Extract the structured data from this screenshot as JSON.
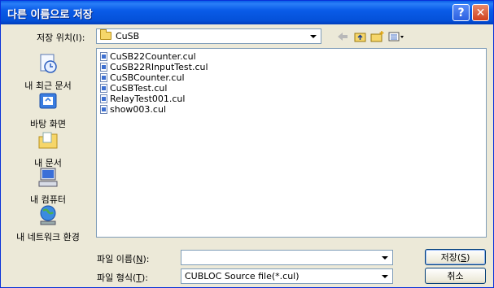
{
  "window": {
    "title": "다른 이름으로 저장",
    "help_glyph": "?",
    "close_glyph": "✕"
  },
  "location": {
    "label": "저장 위치(I):",
    "value": "CuSB"
  },
  "toolbar": {
    "icons": [
      "back-arrow-icon",
      "up-folder-icon",
      "new-folder-icon",
      "view-menu-icon"
    ]
  },
  "places": [
    {
      "label": "내 최근 문서",
      "icon": "recent-documents-icon"
    },
    {
      "label": "바탕 화면",
      "icon": "desktop-icon"
    },
    {
      "label": "내 문서",
      "icon": "my-documents-icon"
    },
    {
      "label": "내 컴퓨터",
      "icon": "my-computer-icon"
    },
    {
      "label": "내 네트워크 환경",
      "icon": "network-places-icon"
    }
  ],
  "files": [
    "CuSB22Counter.cul",
    "CuSB22RInputTest.cul",
    "CuSBCounter.cul",
    "CuSBTest.cul",
    "RelayTest001.cul",
    "show003.cul"
  ],
  "filename": {
    "label_prefix": "파일 이름(",
    "label_key": "N",
    "label_suffix": "):",
    "value": ""
  },
  "filetype": {
    "label_prefix": "파일 형식(",
    "label_key": "T",
    "label_suffix": "):",
    "value": "CUBLOC Source file(*.cul)"
  },
  "buttons": {
    "save_prefix": "저장(",
    "save_key": "S",
    "save_suffix": ")",
    "cancel": "취소"
  },
  "colors": {
    "titlebar": "#0a5ce8",
    "face": "#ece9d8",
    "border": "#7f9db9"
  }
}
